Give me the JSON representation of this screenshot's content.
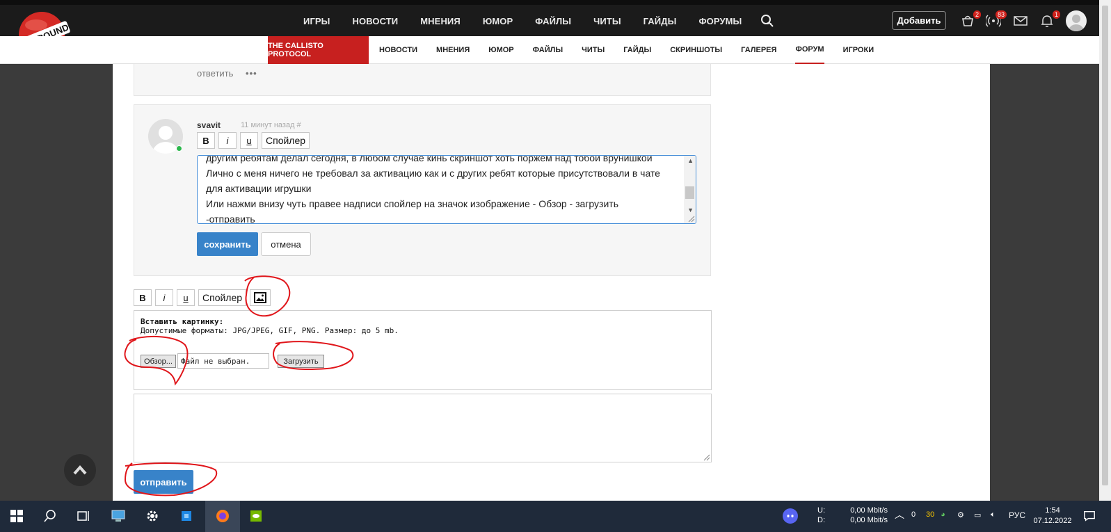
{
  "logo": {
    "text": "PLAYGROUND"
  },
  "top_nav": [
    "ИГРЫ",
    "НОВОСТИ",
    "МНЕНИЯ",
    "ЮМОР",
    "ФАЙЛЫ",
    "ЧИТЫ",
    "ГАЙДЫ",
    "ФОРУМЫ",
    "..."
  ],
  "header": {
    "add_label": "Добавить",
    "badges": {
      "cart": "2",
      "broadcast": "83",
      "notifications": "1"
    }
  },
  "game_tab": "THE CALLISTO PROTOCOL",
  "sub_nav": [
    "НОВОСТИ",
    "МНЕНИЯ",
    "ЮМОР",
    "ФАЙЛЫ",
    "ЧИТЫ",
    "ГАЙДЫ",
    "СКРИНШОТЫ",
    "ГАЛЕРЕЯ",
    "ФОРУМ",
    "ИГРОКИ"
  ],
  "sub_nav_active": "ФОРУМ",
  "prev_comment": {
    "reply_label": "ответить",
    "more_label": "•••"
  },
  "comment": {
    "author": "svavit",
    "meta": "11 минут назад #",
    "format": {
      "bold": "B",
      "italic": "i",
      "underline": "u",
      "spoiler": "Спойлер"
    },
    "edit_lines": [
      "другим ребятам делал сегодня, в любом случае кинь скриншот хоть поржём над тобой врунишкой",
      "Лично с меня ничего не требовал за активацию как и с других ребят которые присутствовали в чате",
      "для активации игрушки",
      "Или нажми внизу чуть правее надписи спойлер на значок изображение - Обзор - загрузить",
      "-отправить"
    ],
    "save_label": "сохранить",
    "cancel_label": "отмена"
  },
  "reply": {
    "format": {
      "bold": "B",
      "italic": "i",
      "underline": "u",
      "spoiler": "Спойлер"
    },
    "upload": {
      "title": "Вставить картинку:",
      "formats": "Допустимые форматы: JPG/JPEG, GIF, PNG. Размер: до 5 mb.",
      "browse_label": "Обзор...",
      "file_status": "Файл не выбран.",
      "upload_label": "Загрузить"
    },
    "send_label": "отправить"
  },
  "taskbar": {
    "net_labels": [
      "U:",
      "D:"
    ],
    "net_values": [
      "0,00 Mbit/s",
      "0,00 Mbit/s"
    ],
    "tray_counts": [
      "0",
      "30"
    ],
    "language": "РУС",
    "time": "1:54",
    "date": "07.12.2022"
  },
  "colors": {
    "accent_red": "#c7201f",
    "button_blue": "#3883c9",
    "annotation_red": "#e0151a"
  }
}
